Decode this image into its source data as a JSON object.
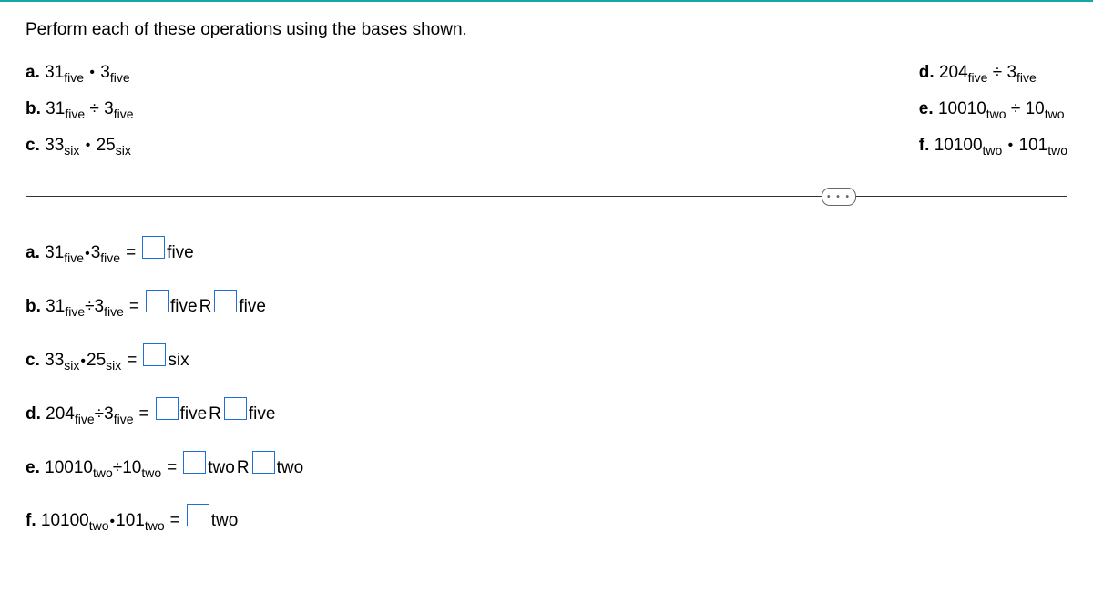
{
  "instruction": "Perform each of these operations using the bases shown.",
  "problems": {
    "a": {
      "label": "a.",
      "lhs": "31",
      "lbase": "five",
      "op": "•",
      "rhs": "3",
      "rbase": "five"
    },
    "b": {
      "label": "b.",
      "lhs": "31",
      "lbase": "five",
      "op": "÷",
      "rhs": "3",
      "rbase": "five"
    },
    "c": {
      "label": "c.",
      "lhs": "33",
      "lbase": "six",
      "op": "•",
      "rhs": "25",
      "rbase": "six"
    },
    "d": {
      "label": "d.",
      "lhs": "204",
      "lbase": "five",
      "op": "÷",
      "rhs": "3",
      "rbase": "five"
    },
    "e": {
      "label": "e.",
      "lhs": "10010",
      "lbase": "two",
      "op": "÷",
      "rhs": "10",
      "rbase": "two"
    },
    "f": {
      "label": "f.",
      "lhs": "10100",
      "lbase": "two",
      "op": "•",
      "rhs": "101",
      "rbase": "two"
    }
  },
  "answers": {
    "a": {
      "label": "a.",
      "lhs": "31",
      "lbase": "five",
      "op": "•",
      "rhs": "3",
      "rbase": "five",
      "eq": "=",
      "ansBase": "five"
    },
    "b": {
      "label": "b.",
      "lhs": "31",
      "lbase": "five",
      "op": "÷",
      "rhs": "3",
      "rbase": "five",
      "eq": "=",
      "ansBase1": "five",
      "R": "R",
      "ansBase2": "five"
    },
    "c": {
      "label": "c.",
      "lhs": "33",
      "lbase": "six",
      "op": "•",
      "rhs": "25",
      "rbase": "six",
      "eq": "=",
      "ansBase": "six"
    },
    "d": {
      "label": "d.",
      "lhs": "204",
      "lbase": "five",
      "op": "÷",
      "rhs": "3",
      "rbase": "five",
      "eq": "=",
      "ansBase1": "five",
      "R": "R",
      "ansBase2": "five"
    },
    "e": {
      "label": "e.",
      "lhs": "10010",
      "lbase": "two",
      "op": "÷",
      "rhs": "10",
      "rbase": "two",
      "eq": "=",
      "ansBase1": "two",
      "R": "R",
      "ansBase2": "two"
    },
    "f": {
      "label": "f.",
      "lhs": "10100",
      "lbase": "two",
      "op": "•",
      "rhs": "101",
      "rbase": "two",
      "eq": "=",
      "ansBase": "two"
    }
  },
  "ellipsis": "• • •"
}
